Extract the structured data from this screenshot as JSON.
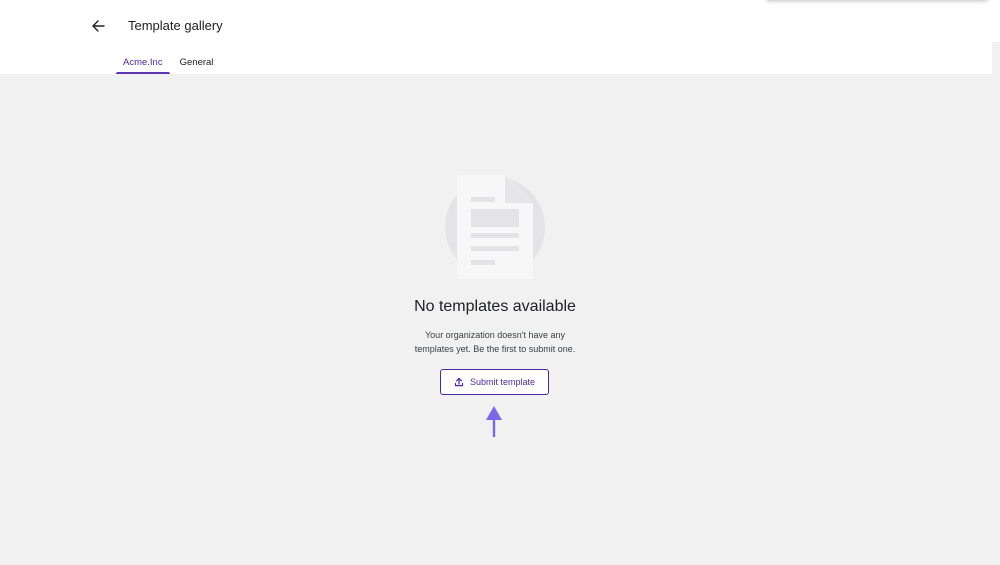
{
  "header": {
    "title": "Template gallery",
    "back_icon": "arrow-left-icon"
  },
  "tabs": [
    {
      "label": "Acme.Inc",
      "active": true
    },
    {
      "label": "General",
      "active": false
    }
  ],
  "empty_state": {
    "illustration_icon": "document-icon",
    "title": "No templates available",
    "description_line1": "Your organization doesn't have any",
    "description_line2": "templates yet. Be the first to submit one.",
    "button_label": "Submit template",
    "button_icon": "upload-icon"
  },
  "annotation": {
    "arrow_icon": "arrow-up-icon",
    "color": "#7b68e8"
  },
  "colors": {
    "accent": "#4b2aa0",
    "background": "#f1f1f1"
  }
}
